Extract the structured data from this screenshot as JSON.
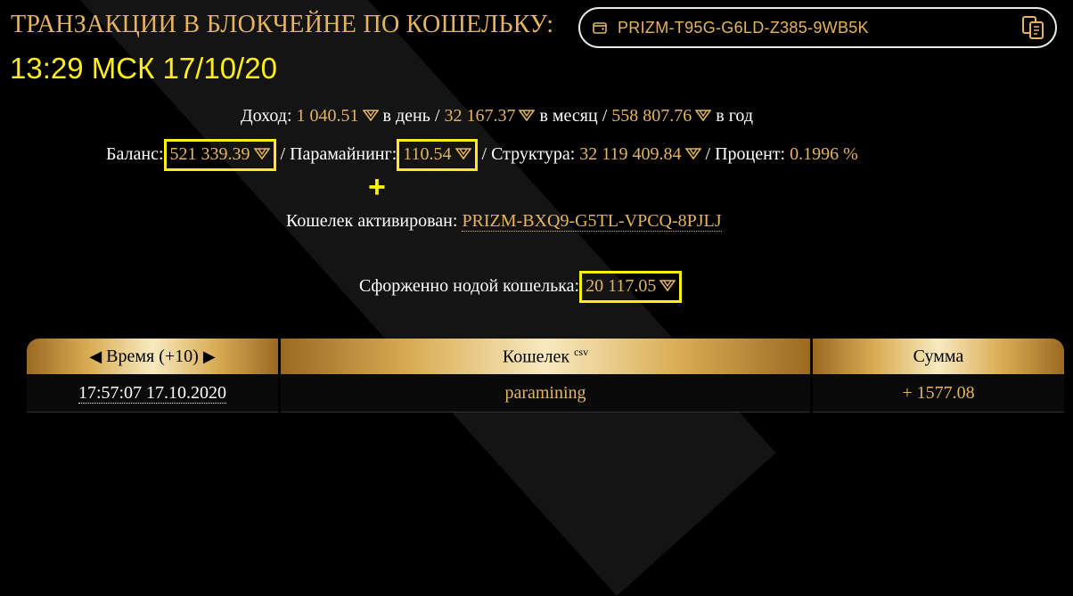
{
  "header": {
    "title": "ТРАНЗАКЦИИ В БЛОКЧЕЙНЕ ПО КОШЕЛЬКУ:",
    "wallet": "PRIZM-T95G-G6LD-Z385-9WB5K"
  },
  "timestamp": "13:29 МСК 17/10/20",
  "income": {
    "label": "Доход:",
    "per_day": "1 040.51",
    "per_day_label": "в день",
    "per_month": "32 167.37",
    "per_month_label": "в месяц",
    "per_year": "558 807.76",
    "per_year_label": "в год"
  },
  "stats": {
    "balance_label": "Баланс:",
    "balance": "521 339.39",
    "paramining_label": "Парамайнинг:",
    "paramining": "110.54",
    "structure_label": "Структура:",
    "structure": "32 119 409.84",
    "percent_label": "Процент:",
    "percent": "0.1996 %"
  },
  "plus_sign": "+",
  "activated": {
    "label": "Кошелек активирован:",
    "wallet": "PRIZM-BXQ9-G5TL-VPCQ-8PJLJ"
  },
  "forged": {
    "label": "Сфорженно нодой кошелька:",
    "value": "20 117.05"
  },
  "table": {
    "col_time": "Время (+10)",
    "prev_arrow": "◀",
    "next_arrow": "▶",
    "col_wallet": "Кошелек",
    "csv": "csv",
    "col_amount": "Сумма",
    "rows": [
      {
        "time": "17:57:07 17.10.2020",
        "wallet": "paramining",
        "amount": "+ 1577.08"
      }
    ]
  },
  "colors": {
    "gold": "#e6b45e",
    "highlight": "#ffef10",
    "background": "#000000"
  },
  "icons": {
    "wallet": "wallet-icon",
    "copy": "copy-icon",
    "coin": "prizm-coin-icon"
  }
}
